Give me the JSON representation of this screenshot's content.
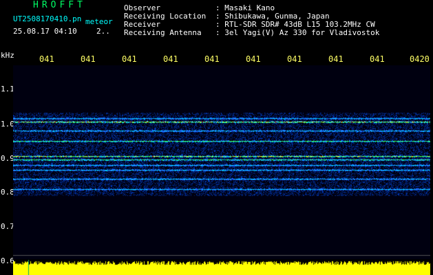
{
  "header": {
    "title": "HROFFT",
    "filename": "UT2508170410.pn",
    "mode": "meteor",
    "datetime": "25.08.17 04:10",
    "counter": "2..",
    "labels": [
      "Observer",
      "Receiving Location",
      "Receiver",
      "Receiving Antenna"
    ],
    "values": [
      ": Masaki Kano",
      ": Shibukawa, Gunma, Japan",
      ": RTL-SDR SDR# 43dB L15 103.2MHz CW",
      ": 3el Yagi(V) Az 330 for Vladivostok"
    ]
  },
  "time_axis": {
    "ticks": [
      "041",
      "041",
      "041",
      "041",
      "041",
      "041",
      "041",
      "041",
      "041",
      "0420"
    ]
  },
  "freq_axis": {
    "unit": "kHz",
    "ticks": [
      "1.1",
      "1.0",
      "0.9",
      "0.8",
      "0.7",
      "0.6"
    ],
    "range": [
      0.6,
      1.15
    ]
  },
  "colors": {
    "background": "#000000",
    "title": "#00ff66",
    "header_text": "#ffffff",
    "file_text": "#00ffff",
    "time_labels": "#ffff66",
    "spectrum": "#ffff00"
  },
  "chart_data": {
    "type": "heatmap",
    "x_label_unit": "minute (UTC)",
    "y_unit": "kHz",
    "freq_range": [
      0.6,
      1.15
    ],
    "signal_band": [
      0.77,
      1.01
    ],
    "strong_lines_khz": [
      0.995,
      0.985,
      0.96,
      0.93,
      0.885,
      0.875,
      0.86,
      0.845,
      0.82,
      0.79
    ]
  }
}
